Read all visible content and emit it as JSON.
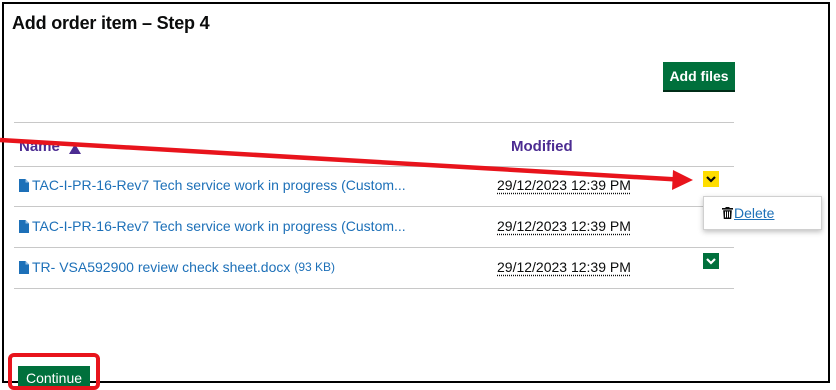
{
  "page": {
    "title": "Add order item – Step 4"
  },
  "toolbar": {
    "add_files_label": "Add files"
  },
  "table": {
    "headers": {
      "name": "Name",
      "modified": "Modified"
    },
    "sort_icon": "sort-ascending-icon",
    "rows": [
      {
        "name": "TAC-I-PR-16-Rev7 Tech service work in progress (Custom...",
        "size": "",
        "modified": "29/12/2023 12:39 PM",
        "action_active": true
      },
      {
        "name": "TAC-I-PR-16-Rev7 Tech service work in progress (Custom...",
        "size": "",
        "modified": "29/12/2023 12:39 PM",
        "action_active": false
      },
      {
        "name": "TR- VSA592900 review check sheet.docx",
        "size": "(93 KB)",
        "modified": "29/12/2023 12:39 PM",
        "action_active": false
      }
    ]
  },
  "menu": {
    "delete_label": "Delete",
    "delete_icon": "trash-icon"
  },
  "footer": {
    "continue_label": "Continue"
  },
  "colors": {
    "primary_green": "#00703c",
    "link_blue": "#1d70b8",
    "header_purple": "#4c2c92",
    "highlight_yellow": "#ffdd00",
    "annotation_red": "#e8141c"
  }
}
